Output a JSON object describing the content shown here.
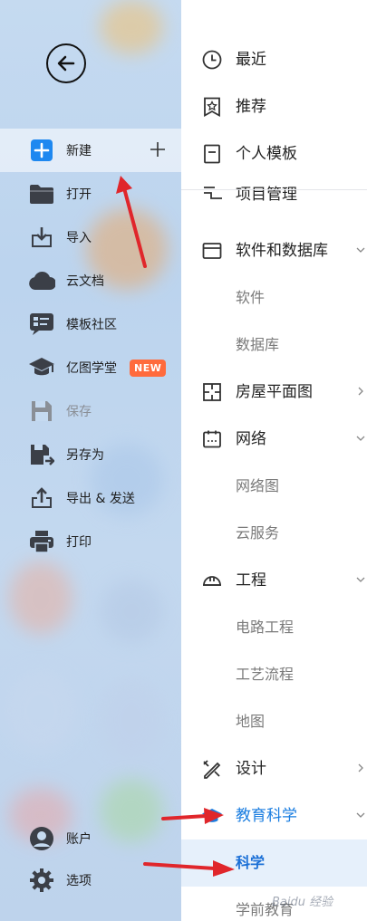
{
  "left_menu": {
    "items": [
      {
        "key": "new",
        "label": "新建",
        "icon": "plus-square-icon"
      },
      {
        "key": "open",
        "label": "打开",
        "icon": "folder-icon"
      },
      {
        "key": "import",
        "label": "导入",
        "icon": "import-icon"
      },
      {
        "key": "cloud",
        "label": "云文档",
        "icon": "cloud-icon"
      },
      {
        "key": "community",
        "label": "模板社区",
        "icon": "community-icon"
      },
      {
        "key": "academy",
        "label": "亿图学堂",
        "icon": "graduation-cap-icon",
        "badge": "NEW"
      },
      {
        "key": "save",
        "label": "保存",
        "icon": "save-icon"
      },
      {
        "key": "saveas",
        "label": "另存为",
        "icon": "save-as-icon"
      },
      {
        "key": "export",
        "label": "导出 & 发送",
        "icon": "export-icon"
      },
      {
        "key": "print",
        "label": "打印",
        "icon": "printer-icon"
      }
    ],
    "account_label": "账户",
    "options_label": "选项"
  },
  "right_menu": {
    "top": [
      {
        "label": "最近",
        "icon": "clock-icon"
      },
      {
        "label": "推荐",
        "icon": "star-bookmark-icon"
      },
      {
        "label": "个人模板",
        "icon": "document-icon"
      }
    ],
    "partial_label": "项目管理",
    "categories": [
      {
        "label": "软件和数据库",
        "icon": "window-icon",
        "expanded": true
      },
      {
        "label": "软件",
        "sub": true
      },
      {
        "label": "数据库",
        "sub": true
      },
      {
        "label": "房屋平面图",
        "icon": "floorplan-icon",
        "expanded": false
      },
      {
        "label": "网络",
        "icon": "calendar-network-icon",
        "expanded": true
      },
      {
        "label": "网络图",
        "sub": true
      },
      {
        "label": "云服务",
        "sub": true
      },
      {
        "label": "工程",
        "icon": "helmet-icon",
        "expanded": true
      },
      {
        "label": "电路工程",
        "sub": true
      },
      {
        "label": "工艺流程",
        "sub": true
      },
      {
        "label": "地图",
        "sub": true
      },
      {
        "label": "设计",
        "icon": "design-tools-icon",
        "expanded": false
      },
      {
        "label": "教育科学",
        "icon": "education-icon",
        "expanded": true,
        "active": true
      },
      {
        "label": "科学",
        "sub": true,
        "selected": true
      },
      {
        "label": "学前教育",
        "sub": true
      }
    ]
  },
  "colors": {
    "accent": "#1a7de0",
    "badge": "#ff6b3d",
    "arrow": "#e0262b"
  },
  "watermark": "Baidu 经验"
}
